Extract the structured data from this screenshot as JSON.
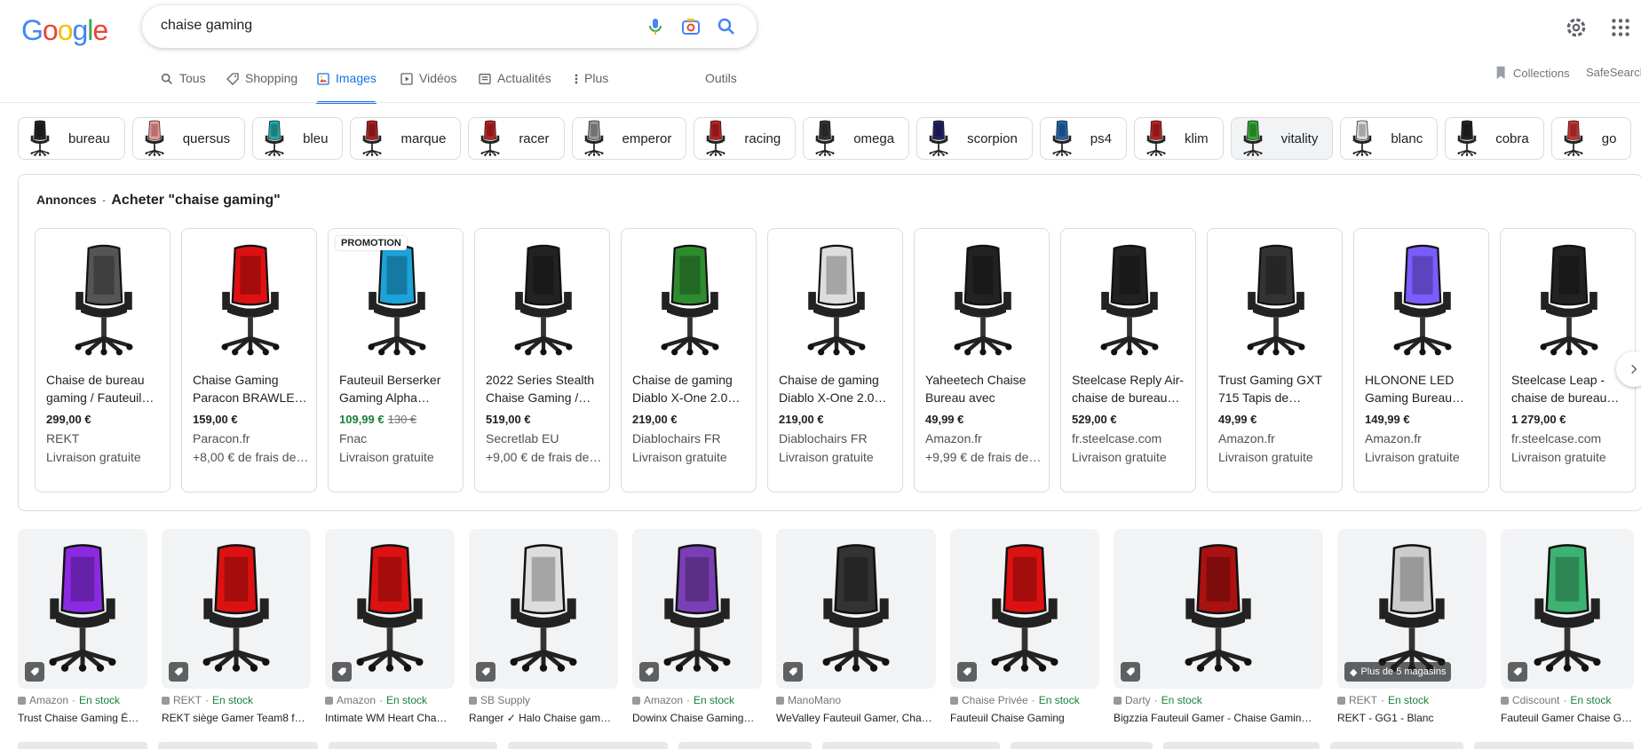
{
  "search": {
    "query": "chaise gaming"
  },
  "tabs": [
    {
      "label": "Tous",
      "icon": "search-icon"
    },
    {
      "label": "Shopping",
      "icon": "tag-icon"
    },
    {
      "label": "Images",
      "icon": "image-icon"
    },
    {
      "label": "Vidéos",
      "icon": "video-icon"
    },
    {
      "label": "Actualités",
      "icon": "news-icon"
    },
    {
      "label": "Plus",
      "icon": "more-vert-icon"
    }
  ],
  "tools_label": "Outils",
  "collections_label": "Collections",
  "safesearch_label": "SafeSearch",
  "chips": [
    "bureau",
    "quersus",
    "bleu",
    "marque",
    "racer",
    "emperor",
    "racing",
    "omega",
    "scorpion",
    "ps4",
    "klim",
    "vitality",
    "blanc",
    "cobra",
    "go"
  ],
  "ads": {
    "label": "Annonces",
    "separator": "·",
    "title": "Acheter \"chaise gaming\"",
    "products": [
      {
        "title": "Chaise de bureau gaming / Fauteuil…",
        "price": "299,00 €",
        "shop": "REKT",
        "ship": "Livraison gratuite",
        "color": "#555"
      },
      {
        "title": "Chaise Gaming Paracon BRAWLE…",
        "price": "159,00 €",
        "shop": "Paracon.fr",
        "ship": "+8,00 € de frais de …",
        "color": "#d11"
      },
      {
        "title": "Fauteuil Berserker Gaming Alpha…",
        "price": "109,99 €",
        "old_price": "130 €",
        "shop": "Fnac",
        "ship": "Livraison gratuite",
        "promo": "PROMOTION",
        "color": "#1ca3d9"
      },
      {
        "title": "2022 Series Stealth Chaise Gaming /…",
        "price": "519,00 €",
        "shop": "Secretlab EU",
        "ship": "+9,00 € de frais de …",
        "color": "#222"
      },
      {
        "title": "Chaise de gaming Diablo X-One 2.0…",
        "price": "219,00 €",
        "shop": "Diablochairs FR",
        "ship": "Livraison gratuite",
        "color": "#2e8b2e"
      },
      {
        "title": "Chaise de gaming Diablo X-One 2.0…",
        "price": "219,00 €",
        "shop": "Diablochairs FR",
        "ship": "Livraison gratuite",
        "color": "#ddd"
      },
      {
        "title": "Yaheetech Chaise Bureau avec Siège…",
        "price": "49,99 €",
        "shop": "Amazon.fr",
        "ship": "+9,99 € de frais de …",
        "color": "#222"
      },
      {
        "title": "Steelcase Reply Air-chaise de bureau…",
        "price": "529,00 €",
        "shop": "fr.steelcase.com",
        "ship": "Livraison gratuite",
        "color": "#222"
      },
      {
        "title": "Trust Gaming GXT 715 Tapis de…",
        "price": "49,99 €",
        "shop": "Amazon.fr",
        "ship": "Livraison gratuite",
        "color": "#333"
      },
      {
        "title": "HLONONE LED Gaming Bureau…",
        "price": "149,99 €",
        "shop": "Amazon.fr",
        "ship": "Livraison gratuite",
        "color": "#7a5cff"
      },
      {
        "title": "Steelcase Leap - chaise de bureau…",
        "price": "1 279,00 €",
        "shop": "fr.steelcase.com",
        "ship": "Livraison gratuite",
        "color": "#222"
      }
    ]
  },
  "images": [
    {
      "source": "Amazon",
      "stock": "En stock",
      "title": "Trust Chaise Gaming É…",
      "accent": "#8a2be2",
      "favicon": "amazon-icon"
    },
    {
      "source": "REKT",
      "stock": "En stock",
      "title": "REKT siège Gamer Team8 f…",
      "accent": "#d11",
      "favicon": "rekt-icon"
    },
    {
      "source": "Amazon",
      "stock": "En stock",
      "title": "Intimate WM Heart Cha…",
      "accent": "#d11",
      "favicon": "amazon-icon"
    },
    {
      "source": "SB Supply",
      "stock": "",
      "title": "Ranger ✓ Halo Chaise gam…",
      "accent": "#ddd",
      "favicon": "sb-icon"
    },
    {
      "source": "Amazon",
      "stock": "En stock",
      "title": "Dowinx Chaise Gaming…",
      "accent": "#7b3fb5",
      "favicon": "amazon-icon"
    },
    {
      "source": "ManoMano",
      "stock": "",
      "title": "WeValley Fauteuil Gamer, Cha…",
      "accent": "#333",
      "favicon": "manomano-icon"
    },
    {
      "source": "Chaise Privée",
      "stock": "En stock",
      "title": "Fauteuil Chaise Gaming",
      "accent": "#d11",
      "favicon": "globe-icon"
    },
    {
      "source": "Darty",
      "stock": "En stock",
      "title": "Bigzzia Fauteuil Gamer - Chaise Gamin…",
      "accent": "#a11",
      "favicon": "darty-icon"
    },
    {
      "source": "REKT",
      "stock": "En stock",
      "title": "REKT - GG1 - Blanc",
      "accent": "#ccc",
      "favicon": "rekt-icon",
      "badge": "Plus de 5 magasins"
    },
    {
      "source": "Cdiscount",
      "stock": "En stock",
      "title": "Fauteuil Gamer Chaise G…",
      "accent": "#3cb371",
      "favicon": "cdiscount-icon"
    }
  ],
  "colors": {
    "accent": "#1a73e8",
    "stock_green": "#188038"
  }
}
